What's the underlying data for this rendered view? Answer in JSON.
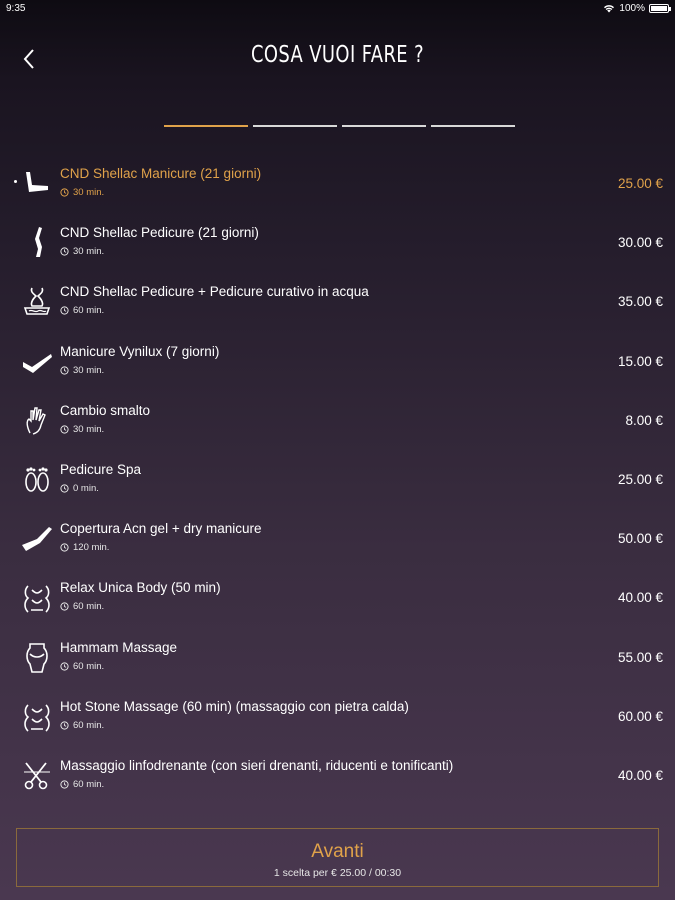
{
  "status": {
    "time": "9:35",
    "battery": "100%"
  },
  "header": {
    "title": "COSA VUOI FARE ?"
  },
  "steps": {
    "total": 4,
    "active": 1
  },
  "services": [
    {
      "name": "CND Shellac Manicure (21 giorni)",
      "duration": "30 min.",
      "price": "25.00 €",
      "icon": "hand-manicure-icon",
      "selected": true
    },
    {
      "name": "CND Shellac Pedicure (21 giorni)",
      "duration": "30 min.",
      "price": "30.00 €",
      "icon": "leg-icon",
      "selected": false
    },
    {
      "name": "CND Shellac Pedicure + Pedicure curativo in acqua",
      "duration": "60 min.",
      "price": "35.00 €",
      "icon": "foot-bath-icon",
      "selected": false
    },
    {
      "name": "Manicure Vynilux  (7 giorni)",
      "duration": "30 min.",
      "price": "15.00 €",
      "icon": "hand-polish-icon",
      "selected": false
    },
    {
      "name": "Cambio smalto",
      "duration": "30 min.",
      "price": "8.00 €",
      "icon": "hand-icon",
      "selected": false
    },
    {
      "name": "Pedicure Spa",
      "duration": "0 min.",
      "price": "25.00 €",
      "icon": "feet-icon",
      "selected": false
    },
    {
      "name": "Copertura Acn gel + dry manicure",
      "duration": "120 min.",
      "price": "50.00 €",
      "icon": "arm-icon",
      "selected": false
    },
    {
      "name": "Relax Unica Body (50 min)",
      "duration": "60 min.",
      "price": "40.00 €",
      "icon": "massage-icon",
      "selected": false
    },
    {
      "name": "Hammam Massage",
      "duration": "60 min.",
      "price": "55.00 €",
      "icon": "body-icon",
      "selected": false
    },
    {
      "name": "Hot Stone Massage (60 min) (massaggio con pietra calda)",
      "duration": "60 min.",
      "price": "60.00 €",
      "icon": "massage-icon",
      "selected": false
    },
    {
      "name": "Massaggio linfodrenante  (con sieri drenanti, riducenti e tonificanti)",
      "duration": "60 min.",
      "price": "40.00 €",
      "icon": "scissors-icon",
      "selected": false
    }
  ],
  "footer": {
    "button_label": "Avanti",
    "summary": "1 scelta per € 25.00 / 00:30"
  },
  "colors": {
    "accent": "#e0a24a",
    "text": "#ffffff"
  }
}
